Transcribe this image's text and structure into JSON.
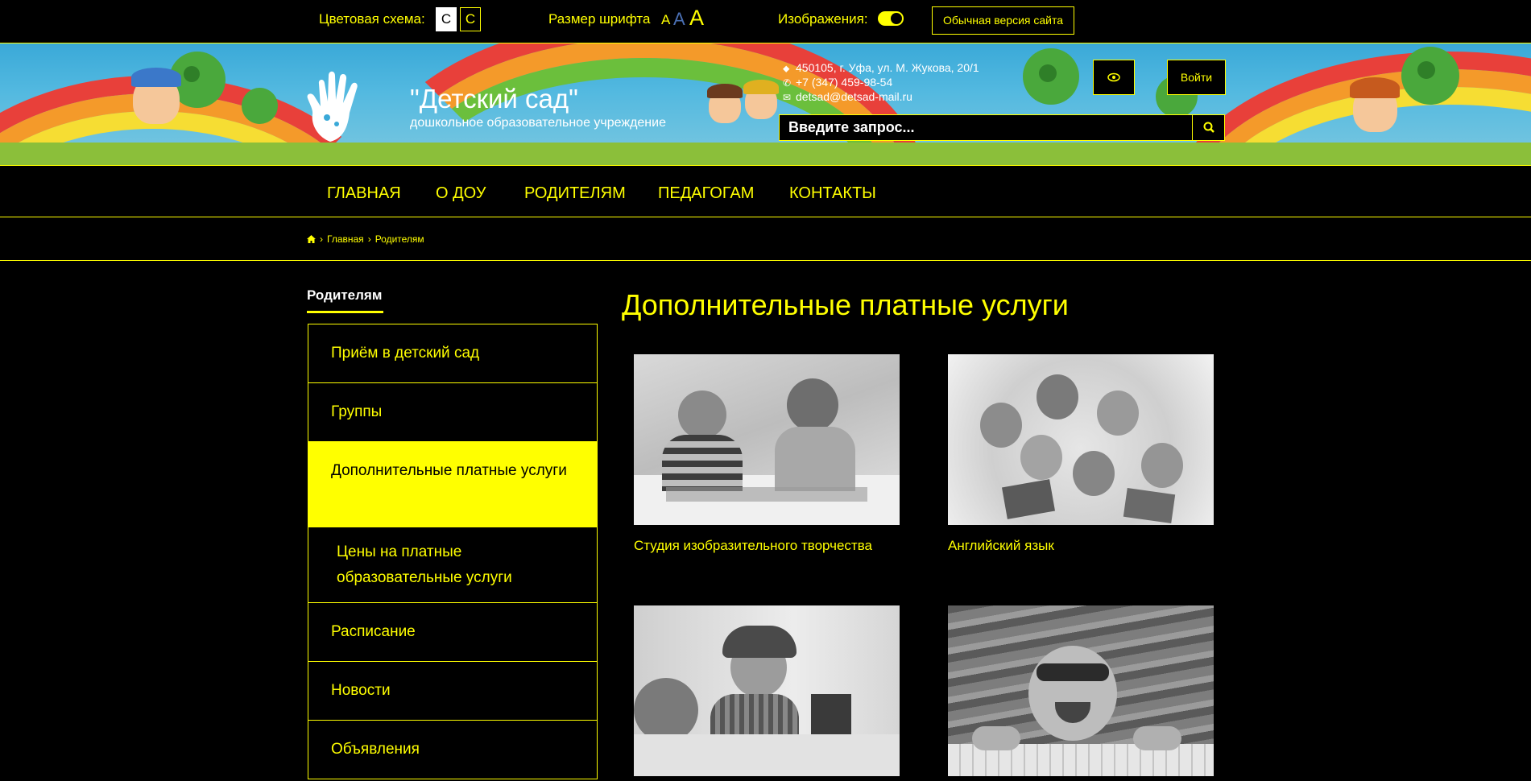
{
  "accessibility_bar": {
    "color_scheme_label": "Цветовая схема:",
    "scheme_white_label": "С",
    "scheme_black_label": "С",
    "font_size_label": "Размер шрифта",
    "font_small": "А",
    "font_medium": "А",
    "font_large": "А",
    "images_label": "Изображения:",
    "images_enabled": true,
    "normal_version_label": "Обычная версия сайта"
  },
  "header": {
    "title": "\"Детский сад\"",
    "subtitle": "дошкольное образовательное учреждение",
    "address": "450105, г. Уфа, ул. М. Жукова, 20/1",
    "phone": "+7 (347) 459-98-54",
    "email": "detsad@detsad-mail.ru",
    "search_placeholder": "Введите запрос...",
    "login_label": "Войти"
  },
  "nav": {
    "items": [
      "ГЛАВНАЯ",
      "О ДОУ",
      "РОДИТЕЛЯМ",
      "ПЕДАГОГАМ",
      "КОНТАКТЫ"
    ]
  },
  "breadcrumb": {
    "home": "Главная",
    "current": "Родителям"
  },
  "sidebar": {
    "heading": "Родителям",
    "items": [
      "Приём в детский сад",
      "Группы",
      "Дополнительные платные услуги",
      "Цены на платные образовательные услуги",
      "Расписание",
      "Новости",
      "Объявления"
    ]
  },
  "main": {
    "title": "Дополнительные платные услуги",
    "cards": [
      {
        "caption": "Студия изобразительного творчества"
      },
      {
        "caption": "Английский язык"
      },
      {
        "caption": ""
      },
      {
        "caption": ""
      }
    ]
  },
  "colors": {
    "background": "#000000",
    "accent": "#ffff00",
    "text_light": "#ffffff"
  }
}
